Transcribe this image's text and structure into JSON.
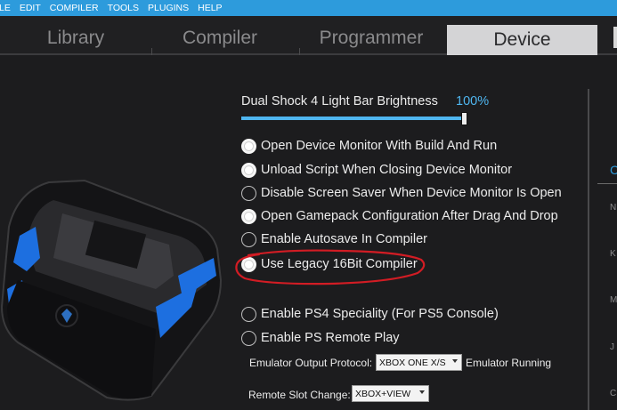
{
  "menu": [
    "LE",
    "EDIT",
    "COMPILER",
    "TOOLS",
    "PLUGINS",
    "HELP"
  ],
  "tabs": [
    {
      "label": "Library",
      "active": false
    },
    {
      "label": "Compiler",
      "active": false
    },
    {
      "label": "Programmer",
      "active": false
    },
    {
      "label": "Device",
      "active": true
    }
  ],
  "brightness": {
    "label": "Dual Shock 4 Light Bar Brightness",
    "value": "100%",
    "level": 1.0
  },
  "options": [
    {
      "label": "Open Device Monitor With Build And Run",
      "checked": true
    },
    {
      "label": "Unload Script When Closing Device Monitor",
      "checked": true
    },
    {
      "label": "Disable Screen Saver When Device Monitor Is Open",
      "checked": false
    },
    {
      "label": "Open Gamepack Configuration After Drag And Drop",
      "checked": true
    },
    {
      "label": "Enable Autosave In Compiler",
      "checked": false
    },
    {
      "label": "Use Legacy 16Bit Compiler",
      "checked": true
    },
    {
      "label": "Enable PS4 Speciality (For PS5 Console)",
      "checked": false
    },
    {
      "label": "Enable PS Remote Play",
      "checked": false
    }
  ],
  "emulator": {
    "label": "Emulator Output Protocol:",
    "value": "XBOX ONE X/S",
    "status": "Emulator Running"
  },
  "remote_slot": {
    "label": "Remote Slot Change:",
    "value": "XBOX+VIEW"
  },
  "right_panel": {
    "letters": [
      "C",
      "N",
      "K",
      "M",
      "J",
      "C"
    ]
  },
  "colors": {
    "accent": "#2d9bdc",
    "annotation": "#d21c24"
  }
}
